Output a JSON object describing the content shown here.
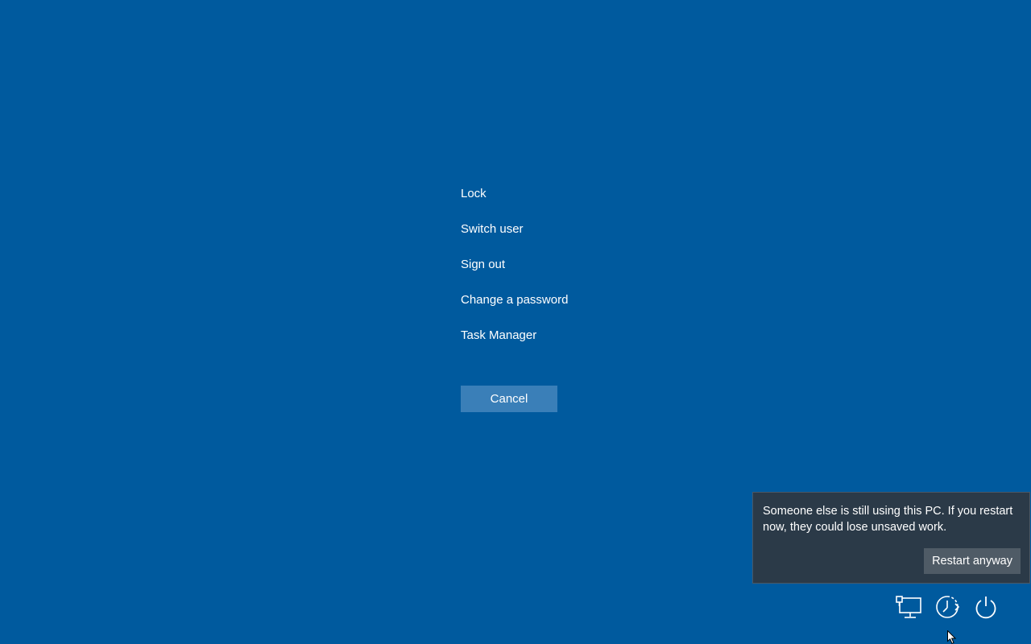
{
  "menu": {
    "items": [
      {
        "label": "Lock"
      },
      {
        "label": "Switch user"
      },
      {
        "label": "Sign out"
      },
      {
        "label": "Change a password"
      },
      {
        "label": "Task Manager"
      }
    ],
    "cancel_label": "Cancel"
  },
  "toast": {
    "message": "Someone else is still using this PC. If you restart now, they could lose unsaved work.",
    "button_label": "Restart anyway"
  },
  "bottom_icons": [
    {
      "icon": "network-icon"
    },
    {
      "icon": "accessibility-icon"
    },
    {
      "icon": "power-icon"
    }
  ],
  "colors": {
    "background": "#005a9e",
    "cancel_button": "#3a7fb8",
    "toast_background": "#2b3a48",
    "toast_button": "#4f5b66",
    "text": "#ffffff"
  }
}
